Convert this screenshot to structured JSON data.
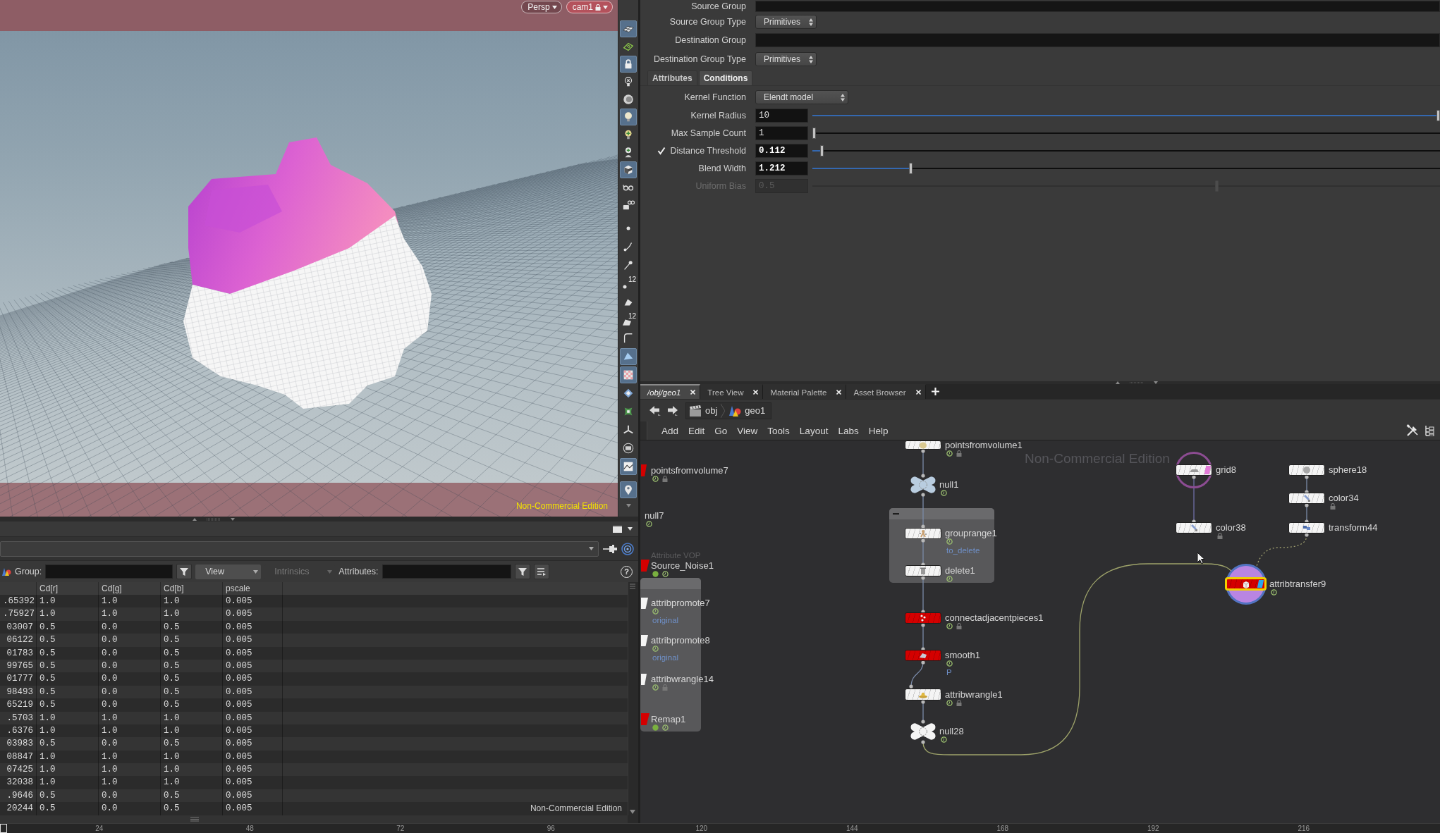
{
  "viewport": {
    "view_menu": "Persp",
    "camera_menu": "cam1",
    "camera_locked": true,
    "edition_label": "Non-Commercial Edition",
    "toolbar": [
      [
        {
          "kind": "grid",
          "selected": true
        },
        {
          "kind": "snap",
          "selected": false
        },
        {
          "kind": "lock",
          "selected": true
        },
        {
          "kind": "light_off",
          "selected": false
        },
        {
          "kind": "dial",
          "selected": false
        },
        {
          "kind": "bulb",
          "selected": true
        },
        {
          "kind": "bulb_plus",
          "selected": false
        },
        {
          "kind": "bulb_figure",
          "selected": false
        },
        {
          "kind": "cube",
          "selected": true
        },
        {
          "kind": "glasses",
          "selected": false
        },
        {
          "kind": "camera_glasses",
          "selected": false
        }
      ],
      [
        {
          "kind": "point",
          "selected": false
        },
        {
          "kind": "point_stroke",
          "selected": false
        },
        {
          "kind": "pin",
          "selected": false
        },
        {
          "kind": "point_number",
          "selected": false,
          "number": "12"
        },
        {
          "kind": "face",
          "selected": false
        },
        {
          "kind": "face_number",
          "selected": false,
          "number": "12"
        },
        {
          "kind": "curve",
          "selected": false
        },
        {
          "kind": "plane",
          "selected": true
        },
        {
          "kind": "checker",
          "selected": true
        },
        {
          "kind": "diamond",
          "selected": false
        },
        {
          "kind": "blob",
          "selected": false
        },
        {
          "kind": "axes",
          "selected": false
        },
        {
          "kind": "ring",
          "selected": false
        },
        {
          "kind": "landscape",
          "selected": true
        }
      ],
      [
        {
          "kind": "map_pin",
          "selected": true
        }
      ]
    ]
  },
  "spreadsheet": {
    "group_label": "Group:",
    "view_menu": "View",
    "intrinsics_menu": "Intrinsics",
    "intrinsics_disabled": true,
    "attributes_label": "Attributes:",
    "help": "?",
    "columns": [
      "",
      "Cd[r]",
      "Cd[g]",
      "Cd[b]",
      "pscale"
    ],
    "rows": [
      [
        ".65392",
        "1.0",
        "1.0",
        "1.0",
        "0.005"
      ],
      [
        ".75927",
        "1.0",
        "1.0",
        "1.0",
        "0.005"
      ],
      [
        "03007",
        "0.5",
        "0.0",
        "0.5",
        "0.005"
      ],
      [
        "06122",
        "0.5",
        "0.0",
        "0.5",
        "0.005"
      ],
      [
        "01783",
        "0.5",
        "0.0",
        "0.5",
        "0.005"
      ],
      [
        "99765",
        "0.5",
        "0.0",
        "0.5",
        "0.005"
      ],
      [
        "01777",
        "0.5",
        "0.0",
        "0.5",
        "0.005"
      ],
      [
        "98493",
        "0.5",
        "0.0",
        "0.5",
        "0.005"
      ],
      [
        "65219",
        "0.5",
        "0.0",
        "0.5",
        "0.005"
      ],
      [
        ".5703",
        "1.0",
        "1.0",
        "1.0",
        "0.005"
      ],
      [
        ".6376",
        "1.0",
        "1.0",
        "1.0",
        "0.005"
      ],
      [
        "03983",
        "0.5",
        "0.0",
        "0.5",
        "0.005"
      ],
      [
        "08847",
        "1.0",
        "1.0",
        "1.0",
        "0.005"
      ],
      [
        "07425",
        "1.0",
        "1.0",
        "1.0",
        "0.005"
      ],
      [
        "32038",
        "1.0",
        "1.0",
        "1.0",
        "0.005"
      ],
      [
        ".9646",
        "0.5",
        "0.0",
        "0.5",
        "0.005"
      ],
      [
        "20244",
        "0.5",
        "0.0",
        "0.5",
        "0.005"
      ]
    ],
    "edition_label": "Non-Commercial Edition"
  },
  "parameters": {
    "rows": [
      {
        "kind": "field",
        "label": "Source Group"
      },
      {
        "kind": "menu",
        "label": "Source Group Type",
        "value": "Primitives"
      },
      {
        "kind": "field",
        "label": "Destination Group"
      },
      {
        "kind": "menu",
        "label": "Destination Group Type",
        "value": "Primitives"
      }
    ],
    "tabs": [
      {
        "label": "Attributes",
        "selected": false
      },
      {
        "label": "Conditions",
        "selected": true
      }
    ],
    "tab_rows": [
      {
        "kind": "menu",
        "label": "Kernel Function",
        "value": "Elendt model"
      },
      {
        "kind": "slider",
        "label": "Kernel Radius",
        "value": "10",
        "level": 1,
        "changed": false,
        "disabled": false
      },
      {
        "kind": "slider",
        "label": "Max Sample Count",
        "value": "1",
        "level": 0,
        "changed": false,
        "disabled": false
      },
      {
        "kind": "toggle_slider",
        "label": "Distance Threshold",
        "value": "0.112",
        "level": 0.012,
        "changed": true,
        "disabled": false,
        "checked": true
      },
      {
        "kind": "slider",
        "label": "Blend Width",
        "value": "1.212",
        "level": 0.155,
        "changed": true,
        "disabled": false
      },
      {
        "kind": "slider",
        "label": "Uniform Bias",
        "value": "0.5",
        "level": 0.645,
        "changed": false,
        "disabled": true
      }
    ]
  },
  "network": {
    "tabs": [
      {
        "label": "/obj/geo1",
        "selected": true
      },
      {
        "label": "Tree View",
        "selected": false
      },
      {
        "label": "Material Palette",
        "selected": false
      },
      {
        "label": "Asset Browser",
        "selected": false
      }
    ],
    "path": [
      {
        "kind": "obj",
        "label": "obj"
      },
      {
        "kind": "geo",
        "label": "geo1"
      }
    ],
    "menu": [
      "Add",
      "Edit",
      "Go",
      "View",
      "Tools",
      "Layout",
      "Labs",
      "Help"
    ],
    "edition_label": "Non-Commercial Edition",
    "nodes": [
      {
        "name": "pointsfromvolume1",
        "kind": "tile",
        "color": "#f4f4f4",
        "flag": true,
        "locked": true,
        "selected": false,
        "display": false,
        "template": false
      },
      {
        "name": "null1",
        "kind": "null",
        "color": "#b9cde0",
        "flag": true,
        "locked": false,
        "selected": false,
        "display": false,
        "template": false
      },
      {
        "name": "grouprange1",
        "kind": "tile",
        "color": "#f4f4f4",
        "flag": true,
        "locked": false,
        "selected": false,
        "display": false,
        "template": false,
        "note": "to_delete"
      },
      {
        "name": "delete1",
        "kind": "tile",
        "color": "#f4f4f4",
        "flag": true,
        "locked": false,
        "selected": false,
        "display": false,
        "template": false
      },
      {
        "name": "connectadjacentpieces1",
        "kind": "tile",
        "color": "#d40000",
        "flag": true,
        "locked": true,
        "selected": false,
        "display": false,
        "template": false
      },
      {
        "name": "smooth1",
        "kind": "tile",
        "color": "#d40000",
        "flag": true,
        "locked": false,
        "selected": false,
        "display": false,
        "template": false,
        "note": "P"
      },
      {
        "name": "attribwrangle1",
        "kind": "tile",
        "color": "#f4f4f4",
        "flag": true,
        "locked": true,
        "selected": false,
        "display": false,
        "template": false
      },
      {
        "name": "null28",
        "kind": "null",
        "color": "#f4f4f4",
        "flag": true,
        "locked": false,
        "selected": false,
        "display": false,
        "template": false
      },
      {
        "name": "pointsfromvolume7",
        "kind": "edge",
        "color": "#d40000",
        "flag": true,
        "locked": true,
        "selected": false,
        "display": false,
        "template": false
      },
      {
        "name": "null7",
        "kind": "offscreen",
        "flag": true,
        "locked": false,
        "selected": false,
        "display": false,
        "template": false
      },
      {
        "name": "Source_Noise1",
        "kind": "vop",
        "color": "#d40000",
        "flag": true,
        "locked": false,
        "selected": false,
        "display": false,
        "template": false,
        "type_label": "Attribute VOP"
      },
      {
        "name": "attribpromote7",
        "kind": "edge",
        "color": "#f4f4f4",
        "flag": true,
        "locked": false,
        "selected": false,
        "display": false,
        "template": false,
        "note": "original"
      },
      {
        "name": "attribpromote8",
        "kind": "edge",
        "color": "#f4f4f4",
        "flag": true,
        "locked": false,
        "selected": false,
        "display": false,
        "template": false,
        "note": "original"
      },
      {
        "name": "attribwrangle14",
        "kind": "edge",
        "color": "#f4f4f4",
        "flag": true,
        "locked": true,
        "selected": false,
        "display": false,
        "template": false
      },
      {
        "name": "Remap1",
        "kind": "vop",
        "color": "#d40000",
        "flag": true,
        "locked": false,
        "selected": false,
        "display": false,
        "template": false
      },
      {
        "name": "grid8",
        "kind": "tile",
        "color": "#f4f4f4",
        "flag": false,
        "locked": false,
        "selected": false,
        "display": false,
        "template": true
      },
      {
        "name": "color38",
        "kind": "tile",
        "color": "#f4f4f4",
        "flag": false,
        "locked": true,
        "selected": false,
        "display": false,
        "template": false
      },
      {
        "name": "sphere18",
        "kind": "tile",
        "color": "#f4f4f4",
        "flag": false,
        "locked": false,
        "selected": false,
        "display": false,
        "template": false
      },
      {
        "name": "color34",
        "kind": "tile",
        "color": "#f4f4f4",
        "flag": false,
        "locked": true,
        "selected": false,
        "display": false,
        "template": false
      },
      {
        "name": "transform44",
        "kind": "tile",
        "color": "#f4f4f4",
        "flag": false,
        "locked": false,
        "selected": false,
        "display": false,
        "template": false
      },
      {
        "name": "attribtransfer9",
        "kind": "tile",
        "color": "#d40000",
        "flag": true,
        "locked": false,
        "selected": true,
        "display": true,
        "template": false
      }
    ]
  },
  "timeline": {
    "ticks": [
      "24",
      "48",
      "72",
      "96",
      "120",
      "144",
      "168",
      "192",
      "216"
    ]
  }
}
